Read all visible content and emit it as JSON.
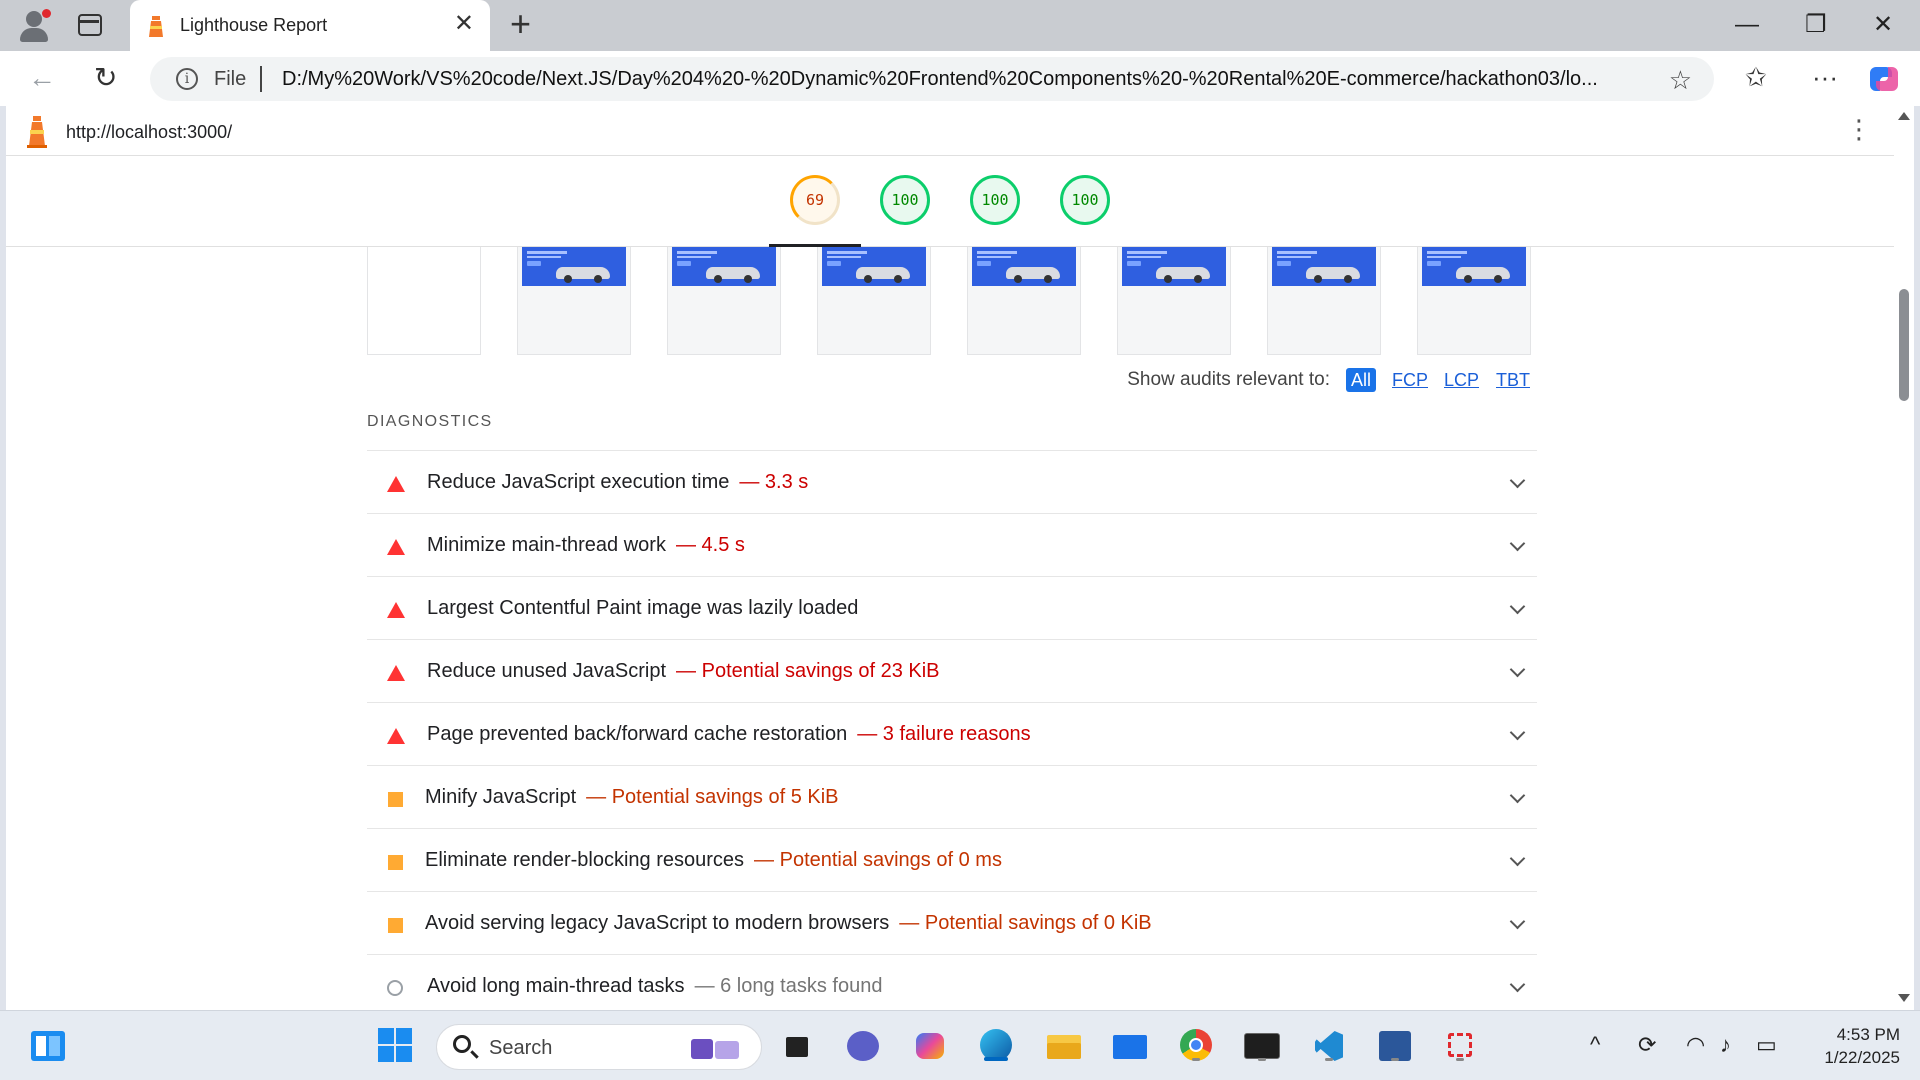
{
  "browser": {
    "tab_title": "Lighthouse Report",
    "address_prefix": "File",
    "url": "D:/My%20Work/VS%20code/Next.JS/Day%204%20-%20Dynamic%20Frontend%20Components%20-%20Rental%20E-commerce/hackathon03/lo..."
  },
  "report": {
    "page_url": "http://localhost:3000/",
    "scores": [
      {
        "value": "69",
        "rating": "average"
      },
      {
        "value": "100",
        "rating": "pass"
      },
      {
        "value": "100",
        "rating": "pass"
      },
      {
        "value": "100",
        "rating": "pass"
      }
    ],
    "filter": {
      "label": "Show audits relevant to:",
      "options": [
        "All",
        "FCP",
        "LCP",
        "TBT"
      ],
      "selected": "All"
    },
    "diagnostics_heading": "DIAGNOSTICS",
    "audits": [
      {
        "status": "fail",
        "title": "Reduce JavaScript execution time",
        "detail": "— 3.3 s"
      },
      {
        "status": "fail",
        "title": "Minimize main-thread work",
        "detail": "— 4.5 s"
      },
      {
        "status": "fail",
        "title": "Largest Contentful Paint image was lazily loaded",
        "detail": ""
      },
      {
        "status": "fail",
        "title": "Reduce unused JavaScript",
        "detail": "— Potential savings of 23 KiB"
      },
      {
        "status": "fail",
        "title": "Page prevented back/forward cache restoration",
        "detail": "— 3 failure reasons"
      },
      {
        "status": "average",
        "title": "Minify JavaScript",
        "detail": "— Potential savings of 5 KiB"
      },
      {
        "status": "average",
        "title": "Eliminate render-blocking resources",
        "detail": "— Potential savings of 0 ms"
      },
      {
        "status": "average",
        "title": "Avoid serving legacy JavaScript to modern browsers",
        "detail": "— Potential savings of 0 KiB"
      },
      {
        "status": "info",
        "title": "Avoid long main-thread tasks",
        "detail": "— 6 long tasks found"
      }
    ]
  },
  "taskbar": {
    "search_placeholder": "Search",
    "time": "4:53 PM",
    "date": "1/22/2025"
  },
  "colors": {
    "fail": "#ff3333",
    "average": "#ffaa33",
    "pass": "#0cce6b",
    "accent": "#1a73e8"
  }
}
